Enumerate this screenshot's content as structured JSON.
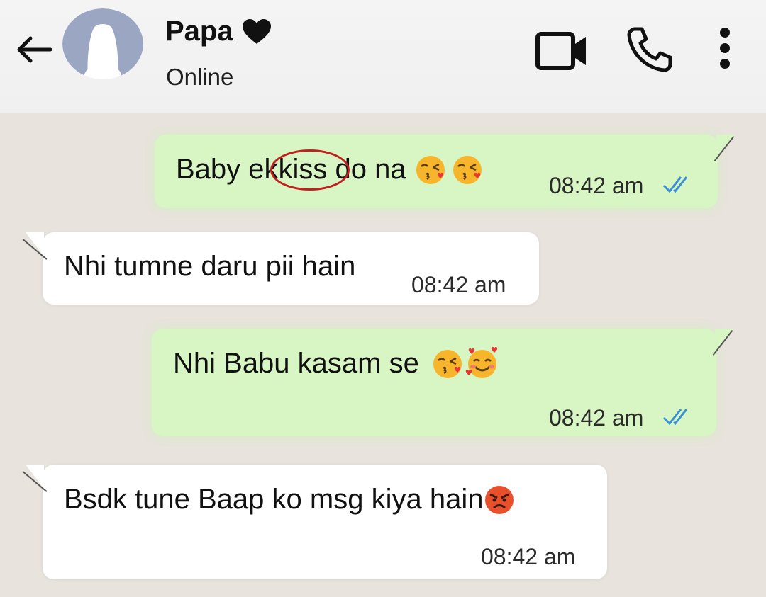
{
  "header": {
    "contact_name": "Papa",
    "status": "Online",
    "icons": {
      "back": "back-arrow-icon",
      "avatar": "default-avatar-icon",
      "name_badge": "heart-icon",
      "video": "video-call-icon",
      "call": "phone-icon",
      "menu": "more-vertical-icon"
    }
  },
  "messages": [
    {
      "direction": "outgoing",
      "text_parts": [
        "Baby ek ",
        "kiss",
        " do na"
      ],
      "emojis": [
        "face-blowing-kiss-emoji",
        "face-blowing-kiss-emoji"
      ],
      "time": "08:42 am",
      "read_receipt": "double-tick-blue"
    },
    {
      "direction": "incoming",
      "text": "Nhi tumne daru pii hain",
      "time": "08:42 am"
    },
    {
      "direction": "outgoing",
      "text": "Nhi Babu kasam se",
      "emojis": [
        "face-blowing-kiss-emoji",
        "smiling-face-with-hearts-emoji"
      ],
      "time": "08:42 am",
      "read_receipt": "double-tick-blue"
    },
    {
      "direction": "incoming",
      "text": "Bsdk tune Baap ko msg kiya hain",
      "emojis": [
        "angry-face-emoji"
      ],
      "time": "08:42 am"
    }
  ],
  "colors": {
    "outgoing_bubble": "#d8f6c3",
    "incoming_bubble": "#ffffff",
    "chat_background": "#e8e3dc",
    "header_background": "#f2f2f2",
    "read_tick": "#3b8fd6",
    "annotation_circle": "#c22020"
  }
}
